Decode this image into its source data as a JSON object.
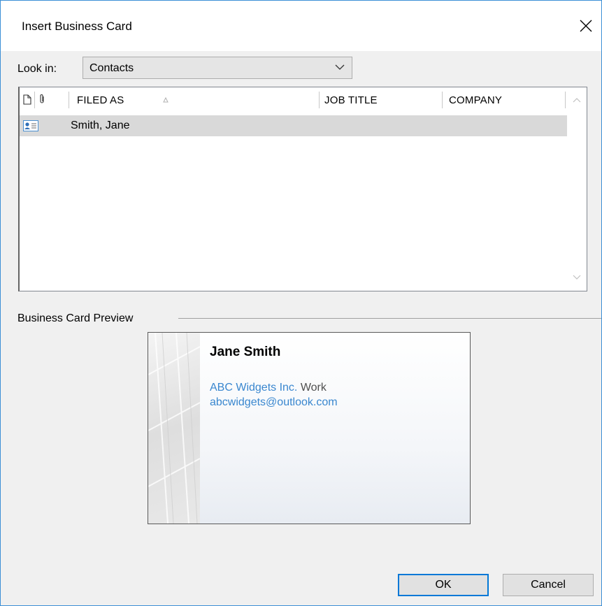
{
  "dialog": {
    "title": "Insert Business Card"
  },
  "look_in": {
    "label": "Look in:",
    "value": "Contacts"
  },
  "list": {
    "columns": [
      "FILED AS",
      "JOB TITLE",
      "COMPANY"
    ],
    "sort_column": "FILED AS",
    "rows": [
      {
        "filed_as": "Smith, Jane",
        "job_title": "",
        "company": "",
        "selected": true
      }
    ]
  },
  "preview": {
    "label": "Business Card Preview",
    "name": "Jane Smith",
    "company": "ABC Widgets Inc.",
    "company_suffix": "Work",
    "email": "abcwidgets@outlook.com"
  },
  "buttons": {
    "ok": "OK",
    "cancel": "Cancel"
  },
  "colors": {
    "accent": "#0078d7",
    "link": "#3a87cf",
    "selection": "#d9d9d9",
    "window_border": "#3c8fd6"
  },
  "icons": [
    "close-icon",
    "chevron-down-icon",
    "document-icon",
    "attachment-icon",
    "sort-ascending-icon",
    "contact-card-icon",
    "scroll-up-icon",
    "scroll-down-icon"
  ]
}
